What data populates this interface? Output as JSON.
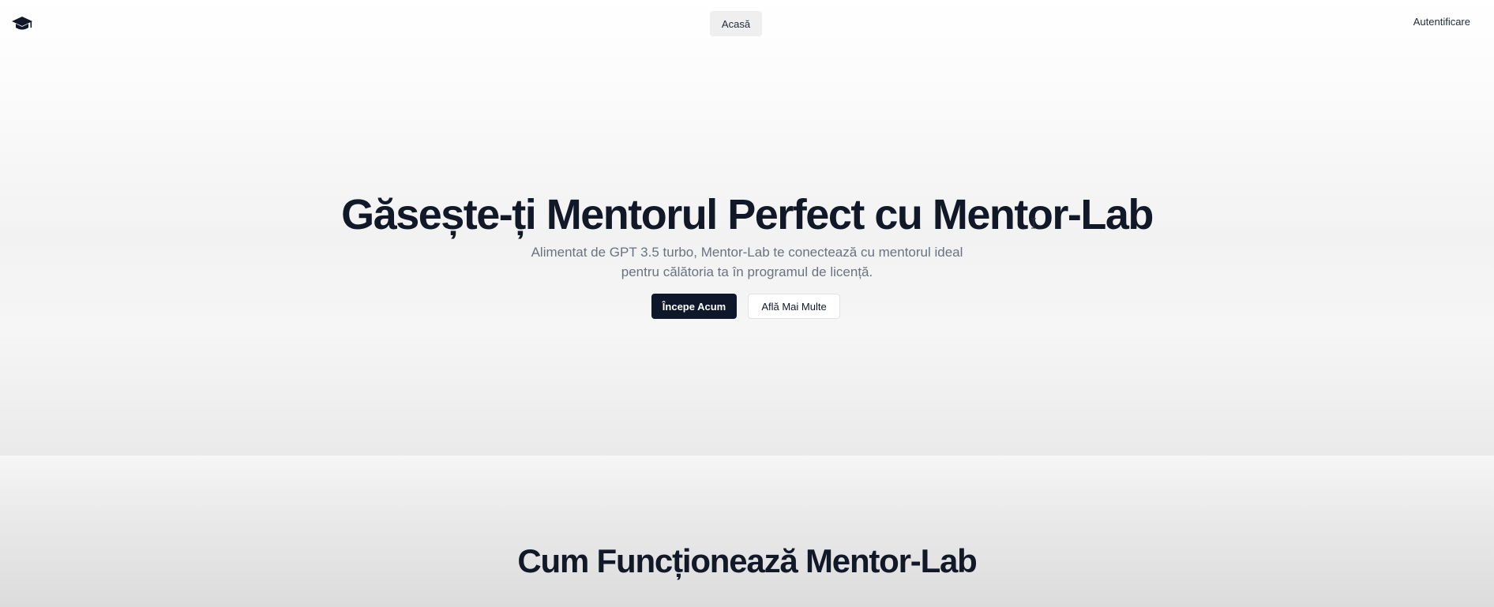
{
  "header": {
    "logo_icon": "graduation-cap-icon",
    "nav_home": "Acasă",
    "nav_login": "Autentificare"
  },
  "hero": {
    "title": "Găsește-ți Mentorul Perfect cu Mentor-Lab",
    "subtitle_line1": "Alimentat de GPT 3.5 turbo, Mentor-Lab te conectează cu mentorul ideal",
    "subtitle_line2": "pentru călătoria ta în programul de licență.",
    "primary_button": "Începe Acum",
    "secondary_button": "Află Mai Multe"
  },
  "section2": {
    "title": "Cum Funcționează Mentor-Lab"
  },
  "colors": {
    "primary": "#0f172a",
    "text_muted": "#6b7280"
  }
}
